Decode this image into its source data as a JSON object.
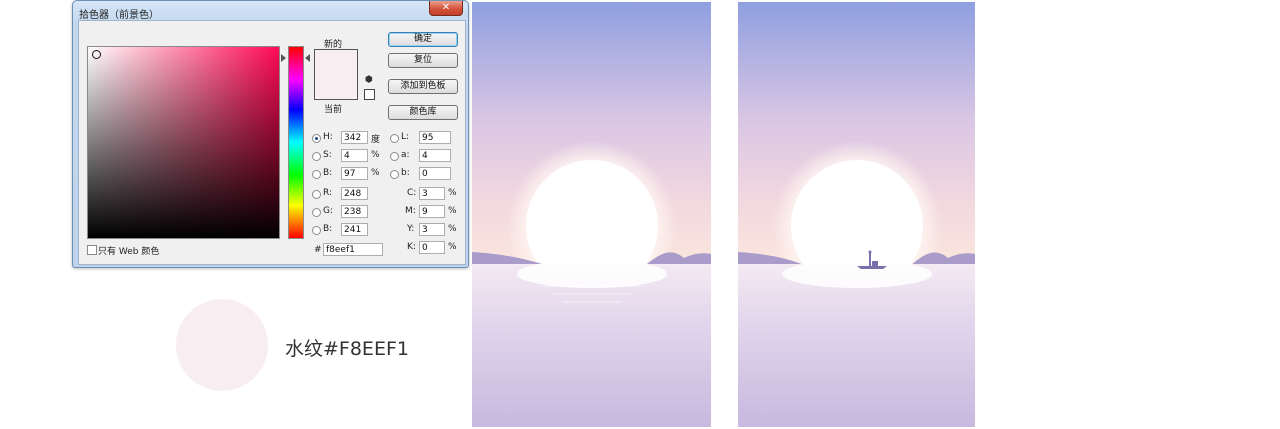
{
  "dialog": {
    "title": "拾色器（前景色）",
    "close_glyph": "✕",
    "new_label": "新的",
    "current_label": "当前",
    "buttons": {
      "ok": "确定",
      "reset": "复位",
      "add_swatch": "添加到色板",
      "libraries": "颜色库"
    },
    "hsb": [
      {
        "label": "H:",
        "value": "342",
        "unit": "度",
        "selected": true
      },
      {
        "label": "S:",
        "value": "4",
        "unit": "%",
        "selected": false
      },
      {
        "label": "B:",
        "value": "97",
        "unit": "%",
        "selected": false
      }
    ],
    "rgb": [
      {
        "label": "R:",
        "value": "248"
      },
      {
        "label": "G:",
        "value": "238"
      },
      {
        "label": "B:",
        "value": "241"
      }
    ],
    "lab": [
      {
        "label": "L:",
        "value": "95"
      },
      {
        "label": "a:",
        "value": "4"
      },
      {
        "label": "b:",
        "value": "0"
      }
    ],
    "cmyk": [
      {
        "label": "C:",
        "value": "3",
        "unit": "%"
      },
      {
        "label": "M:",
        "value": "9",
        "unit": "%"
      },
      {
        "label": "Y:",
        "value": "3",
        "unit": "%"
      },
      {
        "label": "K:",
        "value": "0",
        "unit": "%"
      }
    ],
    "hex_label": "#",
    "hex_value": "f8eef1",
    "web_only_label": "只有 Web 颜色",
    "cube_icon_glyph": "⬢",
    "new_color": "#f8eef1",
    "current_color": "#f8eef1"
  },
  "swatch": {
    "color": "#f8eef1",
    "caption": "水纹#F8EEF1"
  },
  "colors": {
    "sky_top": "#8f9fe0",
    "sky_mid": "#ecd3e0",
    "horizon": "#fbe6de",
    "sun": "#ffffff",
    "hills": "#a99ccb",
    "water_top": "#f4eaf2",
    "water_bottom": "#c7b9df"
  }
}
